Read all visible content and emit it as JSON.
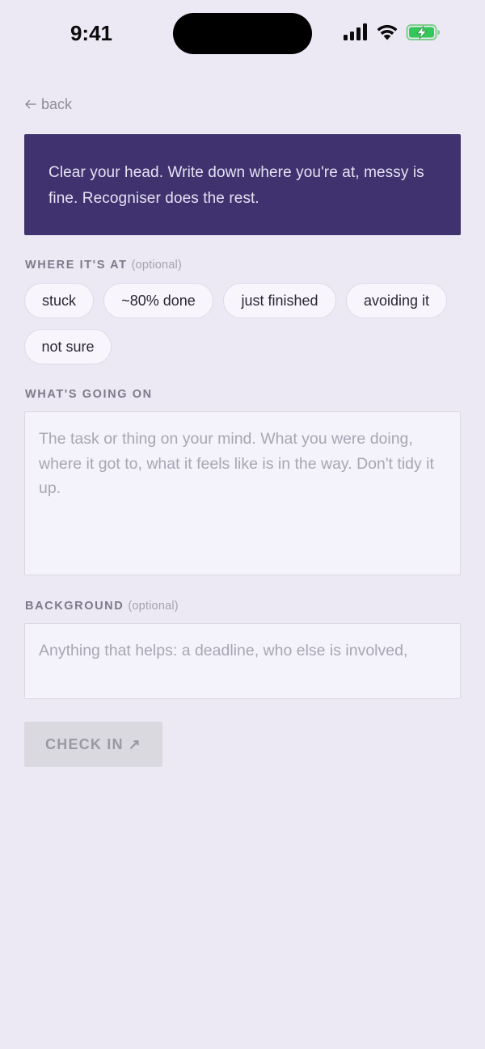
{
  "status_bar": {
    "time": "9:41"
  },
  "nav": {
    "back_label": "back"
  },
  "intro": {
    "text": "Clear your head. Write down where you're at, messy is fine. Recogniser does the rest."
  },
  "status_section": {
    "label": "WHERE IT'S AT",
    "optional": "(optional)",
    "chips": [
      "stuck",
      "~80% done",
      "just finished",
      "avoiding it",
      "not sure"
    ]
  },
  "going_on_section": {
    "label": "WHAT'S GOING ON",
    "placeholder": "The task or thing on your mind. What you were doing, where it got to, what it feels like is in the way. Don't tidy it up.",
    "value": ""
  },
  "background_section": {
    "label": "BACKGROUND",
    "optional": "(optional)",
    "placeholder": "Anything that helps: a deadline, who else is involved,",
    "value": ""
  },
  "submit": {
    "label": "CHECK IN",
    "arrow": "↗"
  },
  "colors": {
    "page_background": "#ECE9F4",
    "banner_background": "#3F326F",
    "banner_text": "#E6E2F3",
    "battery_green": "#34C759",
    "button_disabled": "#DBD9E0"
  },
  "icons": [
    "signal-icon",
    "wifi-icon",
    "battery-charging-icon",
    "back-arrow-icon",
    "arrow-up-right-icon"
  ]
}
